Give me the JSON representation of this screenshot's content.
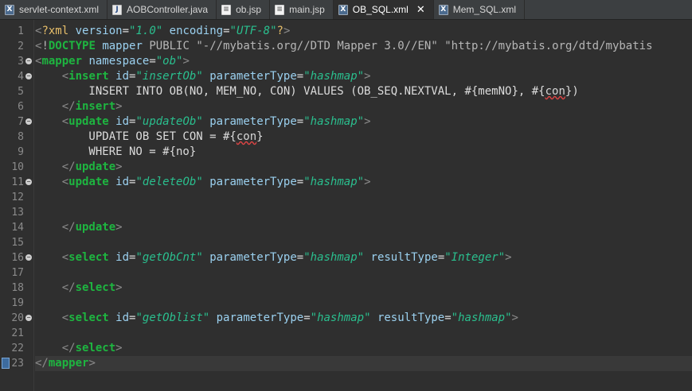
{
  "tabs": [
    {
      "name": "tab-servlet-context",
      "label": "servlet-context.xml",
      "icon": "xml-file-icon",
      "active": false
    },
    {
      "name": "tab-aobcontroller",
      "label": "AOBController.java",
      "icon": "java-file-icon",
      "active": false
    },
    {
      "name": "tab-ob-jsp",
      "label": "ob.jsp",
      "icon": "jsp-file-icon",
      "active": false
    },
    {
      "name": "tab-main-jsp",
      "label": "main.jsp",
      "icon": "jsp-file-icon",
      "active": false
    },
    {
      "name": "tab-ob-sql",
      "label": "OB_SQL.xml",
      "icon": "xml-file-icon",
      "active": true,
      "close": "✕"
    },
    {
      "name": "tab-mem-sql",
      "label": "Mem_SQL.xml",
      "icon": "xml-file-icon",
      "active": false
    }
  ],
  "editor": {
    "current_line": 23,
    "lines": [
      {
        "n": "1",
        "fold": false,
        "segs": [
          [
            "t-br",
            "<"
          ],
          [
            "t-pi",
            "?xml"
          ],
          [
            "t-txt",
            " "
          ],
          [
            "t-attr",
            "version"
          ],
          [
            "t-txt",
            "="
          ],
          [
            "t-str",
            "\"1.0\""
          ],
          [
            "t-txt",
            " "
          ],
          [
            "t-attr",
            "encoding"
          ],
          [
            "t-txt",
            "="
          ],
          [
            "t-str",
            "\"UTF-8\""
          ],
          [
            "t-pi",
            "?"
          ],
          [
            "t-br",
            ">"
          ]
        ]
      },
      {
        "n": "2",
        "fold": false,
        "segs": [
          [
            "t-br",
            "<"
          ],
          [
            "t-dt",
            "!"
          ],
          [
            "t-tag",
            "DOCTYPE"
          ],
          [
            "t-txt",
            " "
          ],
          [
            "t-attr",
            "mapper"
          ],
          [
            "t-txt",
            " "
          ],
          [
            "t-dt",
            "PUBLIC"
          ],
          [
            "t-txt",
            " "
          ],
          [
            "t-dt",
            "\"-//mybatis.org//DTD Mapper 3.0//EN\""
          ],
          [
            "t-txt",
            " "
          ],
          [
            "t-dt",
            "\"http://mybatis.org/dtd/mybatis"
          ]
        ]
      },
      {
        "n": "3",
        "fold": true,
        "segs": [
          [
            "t-br",
            "<"
          ],
          [
            "t-tag",
            "mapper"
          ],
          [
            "t-txt",
            " "
          ],
          [
            "t-attr",
            "namespace"
          ],
          [
            "t-txt",
            "="
          ],
          [
            "t-str",
            "\"ob\""
          ],
          [
            "t-br",
            ">"
          ]
        ]
      },
      {
        "n": "4",
        "fold": true,
        "segs": [
          [
            "t-txt",
            "    "
          ],
          [
            "t-br",
            "<"
          ],
          [
            "t-tag",
            "insert"
          ],
          [
            "t-txt",
            " "
          ],
          [
            "t-attr",
            "id"
          ],
          [
            "t-txt",
            "="
          ],
          [
            "t-str",
            "\"insertOb\""
          ],
          [
            "t-txt",
            " "
          ],
          [
            "t-attr",
            "parameterType"
          ],
          [
            "t-txt",
            "="
          ],
          [
            "t-str",
            "\"hashmap\""
          ],
          [
            "t-br",
            ">"
          ]
        ]
      },
      {
        "n": "5",
        "fold": false,
        "segs": [
          [
            "t-txt",
            "        INSERT INTO OB(NO, MEM_NO, CON) VALUES (OB_SEQ.NEXTVAL, #{memNO}, #{"
          ],
          [
            "t-sq",
            "con"
          ],
          [
            "t-txt",
            "})"
          ]
        ]
      },
      {
        "n": "6",
        "fold": false,
        "segs": [
          [
            "t-txt",
            "    "
          ],
          [
            "t-br",
            "</"
          ],
          [
            "t-tag",
            "insert"
          ],
          [
            "t-br",
            ">"
          ]
        ]
      },
      {
        "n": "7",
        "fold": true,
        "segs": [
          [
            "t-txt",
            "    "
          ],
          [
            "t-br",
            "<"
          ],
          [
            "t-tag",
            "update"
          ],
          [
            "t-txt",
            " "
          ],
          [
            "t-attr",
            "id"
          ],
          [
            "t-txt",
            "="
          ],
          [
            "t-str",
            "\"updateOb\""
          ],
          [
            "t-txt",
            " "
          ],
          [
            "t-attr",
            "parameterType"
          ],
          [
            "t-txt",
            "="
          ],
          [
            "t-str",
            "\"hashmap\""
          ],
          [
            "t-br",
            ">"
          ]
        ]
      },
      {
        "n": "8",
        "fold": false,
        "segs": [
          [
            "t-txt",
            "        UPDATE OB SET CON = #{"
          ],
          [
            "t-sq",
            "con"
          ],
          [
            "t-txt",
            "}"
          ]
        ]
      },
      {
        "n": "9",
        "fold": false,
        "segs": [
          [
            "t-txt",
            "        WHERE NO = #{no}"
          ]
        ]
      },
      {
        "n": "10",
        "fold": false,
        "segs": [
          [
            "t-txt",
            "    "
          ],
          [
            "t-br",
            "</"
          ],
          [
            "t-tag",
            "update"
          ],
          [
            "t-br",
            ">"
          ]
        ]
      },
      {
        "n": "11",
        "fold": true,
        "segs": [
          [
            "t-txt",
            "    "
          ],
          [
            "t-br",
            "<"
          ],
          [
            "t-tag",
            "update"
          ],
          [
            "t-txt",
            " "
          ],
          [
            "t-attr",
            "id"
          ],
          [
            "t-txt",
            "="
          ],
          [
            "t-str",
            "\"deleteOb\""
          ],
          [
            "t-txt",
            " "
          ],
          [
            "t-attr",
            "parameterType"
          ],
          [
            "t-txt",
            "="
          ],
          [
            "t-str",
            "\"hashmap\""
          ],
          [
            "t-br",
            ">"
          ]
        ]
      },
      {
        "n": "12",
        "fold": false,
        "segs": []
      },
      {
        "n": "13",
        "fold": false,
        "segs": []
      },
      {
        "n": "14",
        "fold": false,
        "segs": [
          [
            "t-txt",
            "    "
          ],
          [
            "t-br",
            "</"
          ],
          [
            "t-tag",
            "update"
          ],
          [
            "t-br",
            ">"
          ]
        ]
      },
      {
        "n": "15",
        "fold": false,
        "segs": []
      },
      {
        "n": "16",
        "fold": true,
        "segs": [
          [
            "t-txt",
            "    "
          ],
          [
            "t-br",
            "<"
          ],
          [
            "t-tag",
            "select"
          ],
          [
            "t-txt",
            " "
          ],
          [
            "t-attr",
            "id"
          ],
          [
            "t-txt",
            "="
          ],
          [
            "t-str",
            "\"getObCnt\""
          ],
          [
            "t-txt",
            " "
          ],
          [
            "t-attr",
            "parameterType"
          ],
          [
            "t-txt",
            "="
          ],
          [
            "t-str",
            "\"hashmap\""
          ],
          [
            "t-txt",
            " "
          ],
          [
            "t-attr",
            "resultType"
          ],
          [
            "t-txt",
            "="
          ],
          [
            "t-str",
            "\"Integer\""
          ],
          [
            "t-br",
            ">"
          ]
        ]
      },
      {
        "n": "17",
        "fold": false,
        "segs": []
      },
      {
        "n": "18",
        "fold": false,
        "segs": [
          [
            "t-txt",
            "    "
          ],
          [
            "t-br",
            "</"
          ],
          [
            "t-tag",
            "select"
          ],
          [
            "t-br",
            ">"
          ]
        ]
      },
      {
        "n": "19",
        "fold": false,
        "segs": []
      },
      {
        "n": "20",
        "fold": true,
        "segs": [
          [
            "t-txt",
            "    "
          ],
          [
            "t-br",
            "<"
          ],
          [
            "t-tag",
            "select"
          ],
          [
            "t-txt",
            " "
          ],
          [
            "t-attr",
            "id"
          ],
          [
            "t-txt",
            "="
          ],
          [
            "t-str",
            "\"getOblist\""
          ],
          [
            "t-txt",
            " "
          ],
          [
            "t-attr",
            "parameterType"
          ],
          [
            "t-txt",
            "="
          ],
          [
            "t-str",
            "\"hashmap\""
          ],
          [
            "t-txt",
            " "
          ],
          [
            "t-attr",
            "resultType"
          ],
          [
            "t-txt",
            "="
          ],
          [
            "t-str",
            "\"hashmap\""
          ],
          [
            "t-br",
            ">"
          ]
        ]
      },
      {
        "n": "21",
        "fold": false,
        "segs": []
      },
      {
        "n": "22",
        "fold": false,
        "segs": [
          [
            "t-txt",
            "    "
          ],
          [
            "t-br",
            "</"
          ],
          [
            "t-tag",
            "select"
          ],
          [
            "t-br",
            ">"
          ]
        ]
      },
      {
        "n": "23",
        "fold": false,
        "segs": [
          [
            "t-br",
            "</"
          ],
          [
            "t-tag",
            "mapper"
          ],
          [
            "t-br",
            ">"
          ]
        ]
      }
    ]
  }
}
